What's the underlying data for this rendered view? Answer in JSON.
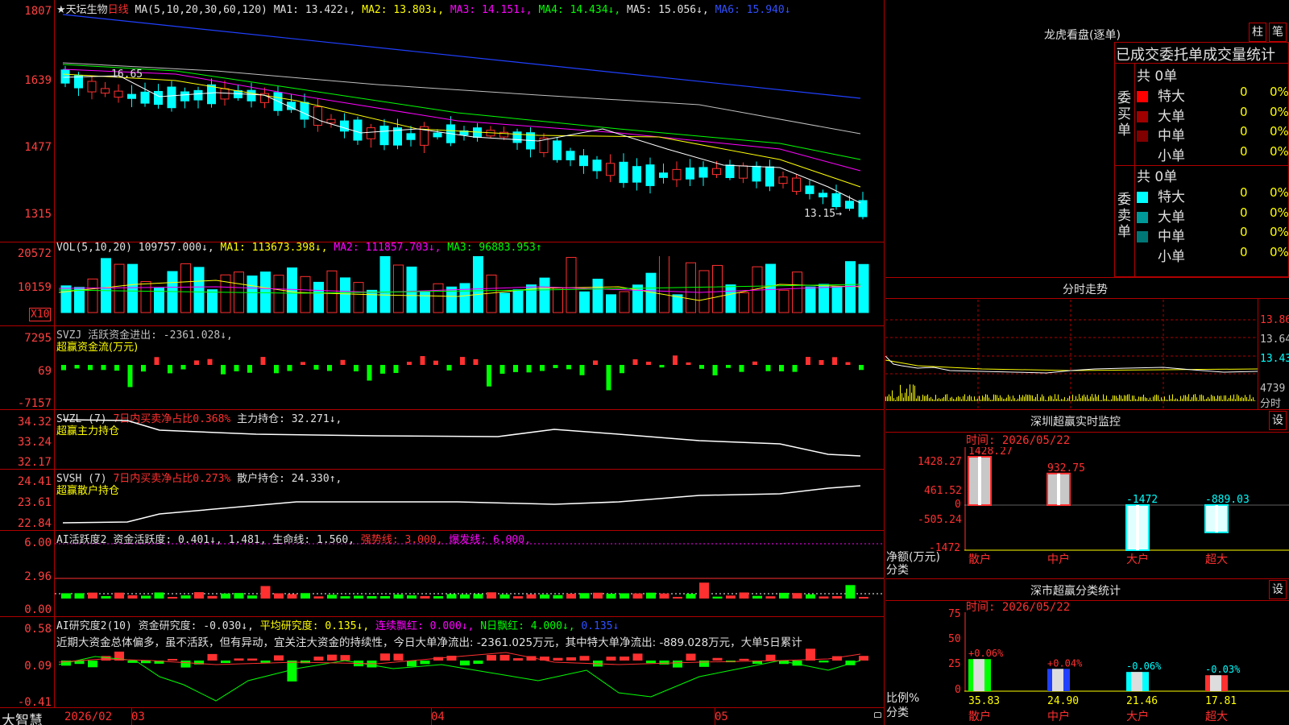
{
  "header": {
    "stock_name": "★天坛生物",
    "period": "日线",
    "ma_prefix": "MA(5,10,20,30,60,120)",
    "ma1": "MA1: 13.422↓,",
    "ma2": "MA2: 13.803↓,",
    "ma3": "MA3: 14.151↓,",
    "ma4": "MA4: 14.434↓,",
    "ma5": "MA5: 15.056↓,",
    "ma6": "MA6: 15.940↓",
    "high_label": "16.65",
    "low_label": "13.15→"
  },
  "price_axis": [
    "1807",
    "1639",
    "1477",
    "1315"
  ],
  "vol": {
    "prefix": "VOL(5,10,20)",
    "value": "109757.000↓,",
    "ma1": "MA1: 113673.398↓,",
    "ma2": "MA2: 111857.703↓,",
    "ma3": "MA3: 96883.953↑",
    "axis": [
      "20572",
      "10159"
    ],
    "unit": "X10"
  },
  "svzj": {
    "line1": "SVZJ  活跃资金进出: -2361.028↓,",
    "line2": "超赢资金流(万元)",
    "axis": [
      "7295",
      "69",
      "-7157"
    ]
  },
  "svzl": {
    "name": "SVZL (7)",
    "ratio": "7日内买卖净占比0.368%",
    "hold": "主力持仓: 32.271↓,",
    "line2": "超赢主力持仓",
    "axis": [
      "34.32",
      "33.24",
      "32.17"
    ]
  },
  "svsh": {
    "name": "SVSH (7)",
    "ratio": "7日内买卖净占比0.273%",
    "hold": "散户持仓: 24.330↑,",
    "line2": "超赢散户持仓",
    "axis": [
      "24.41",
      "23.61",
      "22.84"
    ]
  },
  "ai_active": {
    "name": "AI活跃度2",
    "a": "资金活跃度: 0.401↓,",
    "b": "1.481,",
    "c": "生命线: 1.560,",
    "d": "强势线: 3.000,",
    "e": "爆发线: 6.000,",
    "axis": [
      "6.00",
      "2.96",
      "0.00"
    ]
  },
  "ai_research": {
    "name": "AI研究度2(10)",
    "a": "资金研究度: -0.030↓,",
    "b": "平均研究度: 0.135↓,",
    "c": "连续飘红: 0.000↓,",
    "d": "N日飘红: 4.000↓,",
    "e": "0.135↓",
    "comment": "近期大资金总体偏多，虽不活跃，但有异动，宜关注大资金的持续性，今日大单净流出: -2361.025万元，其中特大单净流出: -889.028万元，大单5日累计",
    "axis": [
      "0.58",
      "0.09",
      "-0.41"
    ]
  },
  "bottom": {
    "brand": "大智慧",
    "dates": [
      "2026/02",
      "03",
      "04",
      "05"
    ]
  },
  "side": {
    "lhb_title": "龙虎看盘(逐单)",
    "btn_zhu": "柱",
    "btn_bi": "笔",
    "stat_header": "已成交委托单成交量统计",
    "buy_label": "委买单",
    "sell_label": "委卖单",
    "buy_total": "共 0单",
    "sell_total": "共 0单",
    "buy_rows": [
      {
        "name": "特大",
        "val": "0",
        "pct": "0%",
        "color": "#ff0000"
      },
      {
        "name": "大单",
        "val": "0",
        "pct": "0%",
        "color": "#a00000"
      },
      {
        "name": "中单",
        "val": "0",
        "pct": "0%",
        "color": "#800000"
      },
      {
        "name": "小单",
        "val": "0",
        "pct": "0%",
        "color": ""
      }
    ],
    "sell_rows": [
      {
        "name": "特大",
        "val": "0",
        "pct": "0%",
        "color": "#00ffff"
      },
      {
        "name": "大单",
        "val": "0",
        "pct": "0%",
        "color": "#009999"
      },
      {
        "name": "中单",
        "val": "0",
        "pct": "0%",
        "color": "#007777"
      },
      {
        "name": "小单",
        "val": "0",
        "pct": "0%",
        "color": ""
      }
    ],
    "fenshi_title": "分时走势",
    "fenshi_axis": [
      "13.86",
      "13.64",
      "13.43",
      "4739",
      "分时"
    ],
    "sz_monitor_title": "深圳超赢实时监控",
    "btn_she": "设",
    "monitor_time": "时间: 2026/05/22",
    "monitor_axis": [
      "1428.27",
      "461.52",
      "0",
      "-505.24",
      "-1472"
    ],
    "monitor_values": [
      "1428.27",
      "932.75",
      "-1472",
      "-889.03"
    ],
    "monitor_ylabel": "净额(万元)",
    "monitor_xlabel": "分类",
    "categories": [
      "散户",
      "中户",
      "大户",
      "超大"
    ],
    "sz_class_title": "深市超赢分类统计",
    "class_time": "时间: 2026/05/22",
    "class_axis": [
      "75",
      "50",
      "25",
      "0"
    ],
    "class_pct": [
      "+0.06%",
      "+0.04%",
      "-0.06%",
      "-0.03%"
    ],
    "class_values": [
      "35.83",
      "24.90",
      "21.46",
      "17.81"
    ],
    "class_ylabel": "比例%",
    "class_xlabel": "分类"
  },
  "chart_data": {
    "type": "bar",
    "title": "深圳超赢实时监控",
    "categories": [
      "散户",
      "中户",
      "大户",
      "超大"
    ],
    "values": [
      1428.27,
      932.75,
      -1472,
      -889.03
    ],
    "ylabel": "净额(万元)",
    "ylim": [
      -1472,
      1428.27
    ]
  },
  "colors": {
    "up": "#ff3030",
    "down": "#00ffff",
    "border": "#b00000"
  }
}
